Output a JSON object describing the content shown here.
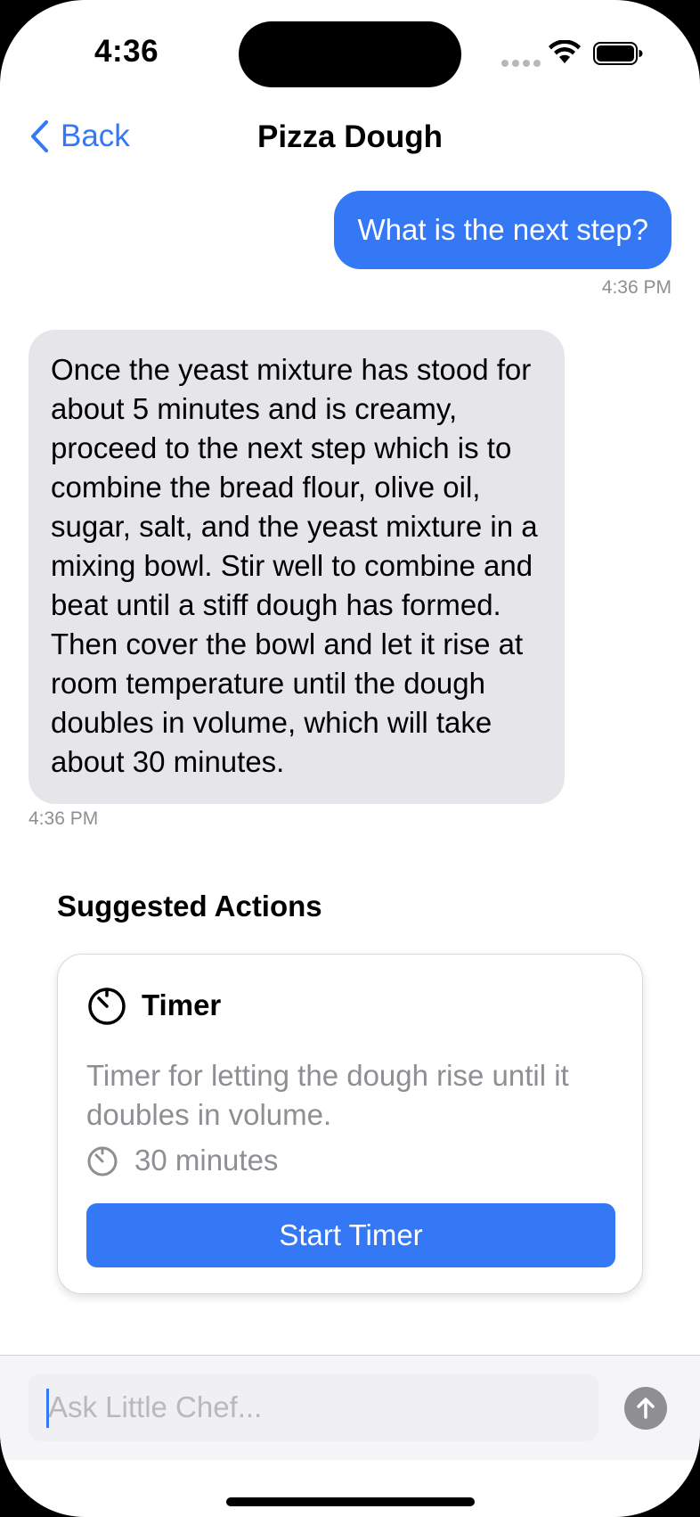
{
  "status_bar": {
    "time": "4:36"
  },
  "nav": {
    "back_label": "Back",
    "title": "Pizza Dough"
  },
  "messages": [
    {
      "role": "user",
      "text": "What is the next step?",
      "time": "4:36 PM"
    },
    {
      "role": "assistant",
      "text": "Once the yeast mixture has stood for about 5 minutes and is creamy, proceed to the next step which is to combine the bread flour, olive oil, sugar, salt, and the yeast mixture in a mixing bowl. Stir well to combine and beat until a stiff dough has formed. Then cover the bowl and let it rise at room temperature until the dough doubles in volume, which will take about 30 minutes.",
      "time": "4:36 PM"
    }
  ],
  "suggested": {
    "title": "Suggested Actions",
    "card": {
      "icon": "timer-icon",
      "title": "Timer",
      "description": "Timer for letting the dough rise until it doubles in volume.",
      "duration": "30 minutes",
      "button_label": "Start Timer"
    }
  },
  "input": {
    "placeholder": "Ask Little Chef...",
    "value": ""
  },
  "colors": {
    "accent": "#3478f6",
    "bubble_gray": "#e5e5ea",
    "muted": "#8e8e93"
  }
}
